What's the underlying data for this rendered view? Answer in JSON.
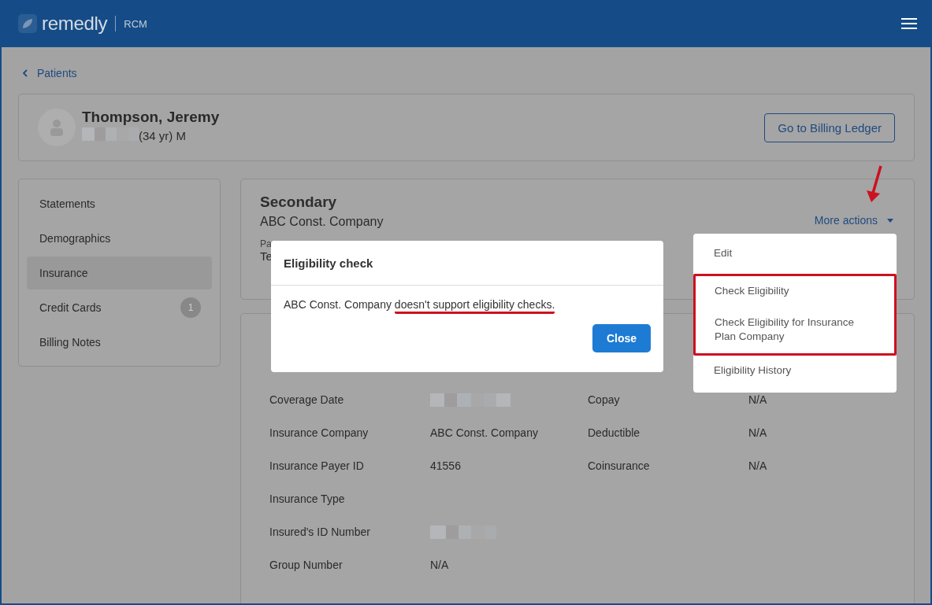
{
  "header": {
    "logo": "remedly",
    "product": "RCM"
  },
  "breadcrumb": {
    "label": "Patients"
  },
  "patient": {
    "name": "Thompson, Jeremy",
    "birth_date_redacted": true,
    "age_sex": "(34 yr) M"
  },
  "ledger_button": "Go to Billing Ledger",
  "sidebar": {
    "items": [
      {
        "label": "Statements",
        "selected": false
      },
      {
        "label": "Demographics",
        "selected": false
      },
      {
        "label": "Insurance",
        "selected": true
      },
      {
        "label": "Credit Cards",
        "selected": false,
        "badge": "1"
      },
      {
        "label": "Billing Notes",
        "selected": false
      }
    ]
  },
  "insurance": {
    "title": "Secondary",
    "company": "ABC Const. Company",
    "field_label_partial": "Pa",
    "field_value_partial": "Te",
    "more_actions": "More actions",
    "pointer_arrow": true
  },
  "details": {
    "rows": [
      {
        "label": "Coverage Date",
        "value_redacted": true,
        "label_2": "Copay",
        "value_2": "N/A"
      },
      {
        "label": "Insurance Company",
        "value": "ABC Const. Company",
        "label_2": "Deductible",
        "value_2": "N/A"
      },
      {
        "label": "Insurance Payer ID",
        "value": "41556",
        "label_2": "Coinsurance",
        "value_2": "N/A"
      },
      {
        "label": "Insurance Type"
      },
      {
        "label": "Insured's ID Number",
        "value_redacted": true
      },
      {
        "label": "Group Number",
        "value": "N/A"
      }
    ]
  },
  "menu": {
    "items": [
      {
        "label": "Edit",
        "highlighted": false
      },
      {
        "label": "Check Eligibility",
        "highlighted": true
      },
      {
        "label": "Check Eligibility for Insurance Plan Company",
        "highlighted": true
      },
      {
        "label": "Eligibility History",
        "highlighted": false
      }
    ]
  },
  "dialog": {
    "title": "Eligibility check",
    "message": "ABC Const. Company ",
    "message_underlined": "doesn't support eligibility checks.",
    "button": "Close"
  }
}
